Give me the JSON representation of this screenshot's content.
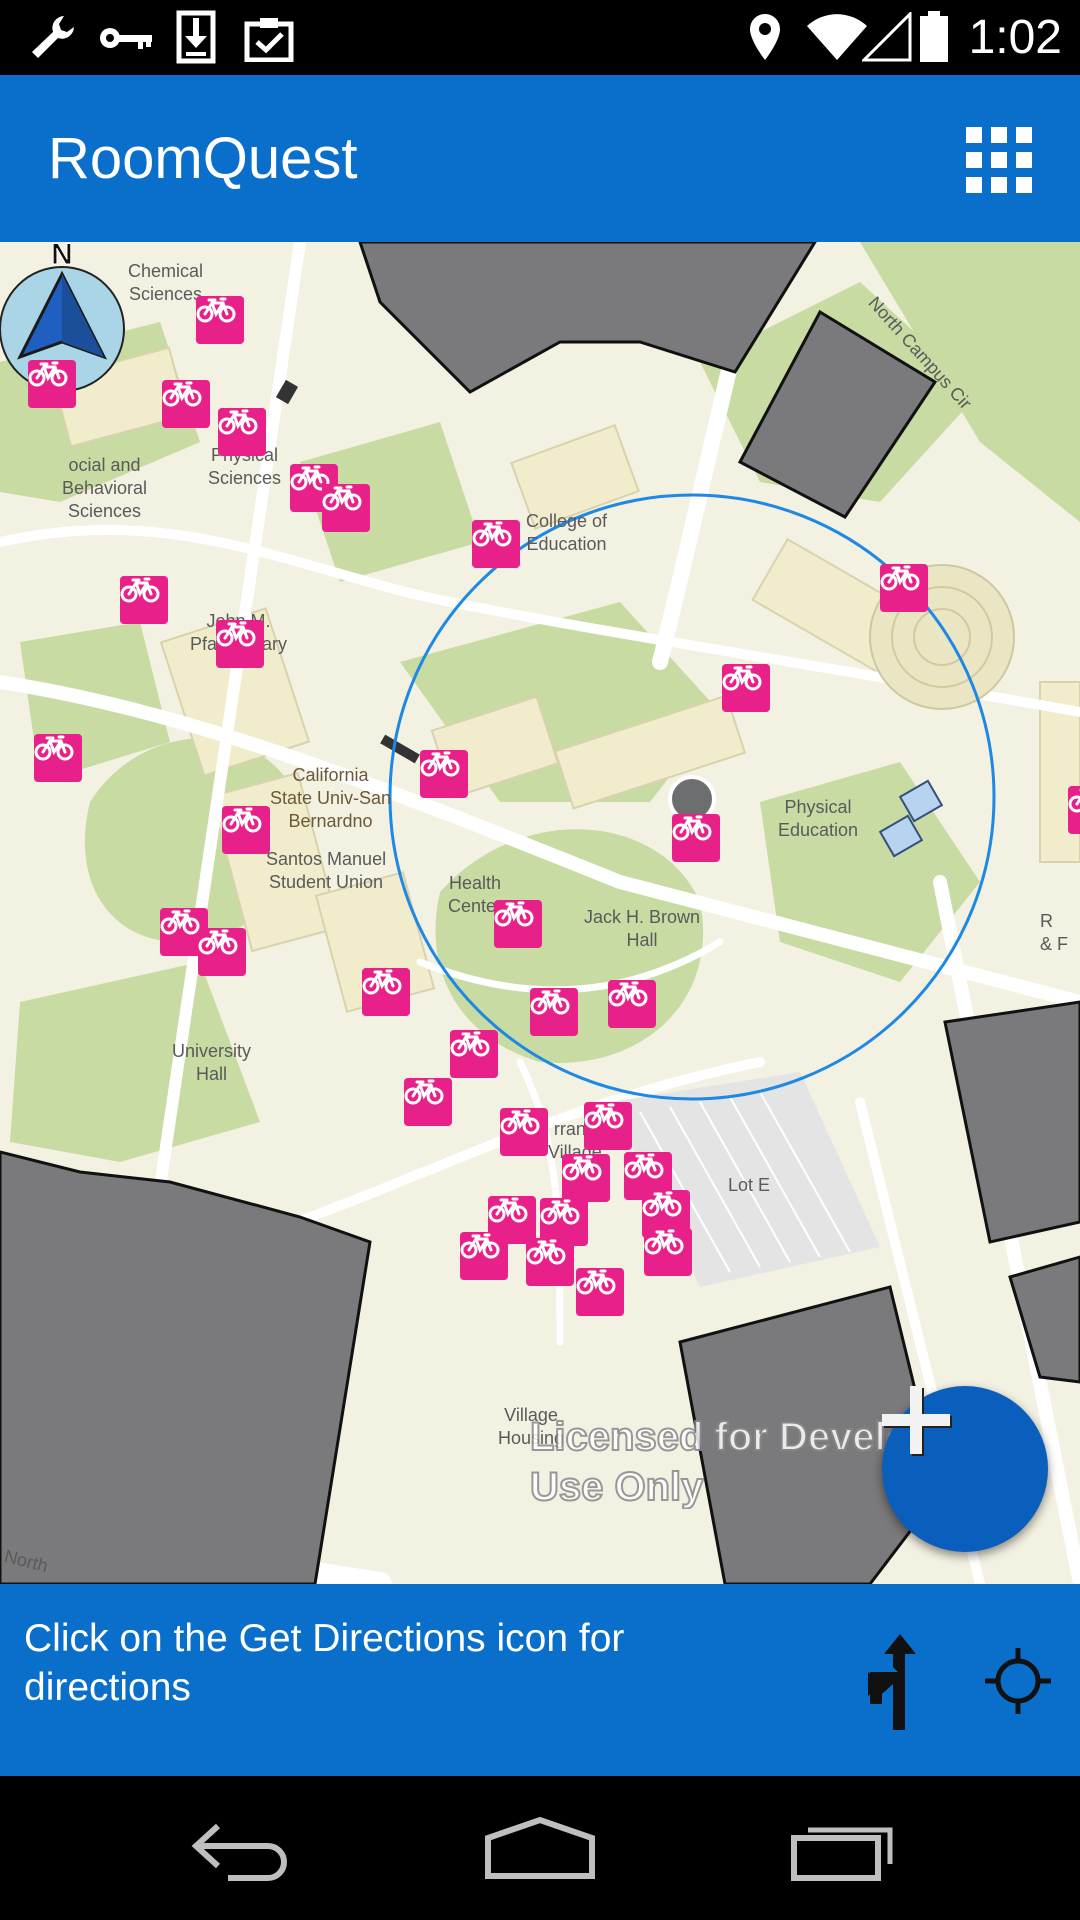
{
  "status_bar": {
    "time": "1:02",
    "left_icons": [
      "wrench-icon",
      "key-icon",
      "download-icon",
      "clipboard-check-icon"
    ],
    "right_icons": [
      "location-pin-icon",
      "wifi-icon",
      "cell-signal-icon",
      "battery-icon"
    ]
  },
  "app_bar": {
    "title": "RoomQuest",
    "menu_icon": "grid-apps-icon"
  },
  "map": {
    "compass_label": "N",
    "labels": {
      "chemical_sciences": "Chemical\nSciences",
      "physical_sciences": "Physical\nSciences",
      "social_behavioral": "ocial and\nBehavioral\nSciences",
      "college_of_education": "College of\nEducation",
      "pfau_library": "John M.\nPfau Library",
      "csusb": "California\nState Univ-San\nBernardno",
      "student_union": "Santos Manuel\nStudent Union",
      "health_center": "Health\nCenter",
      "jack_brown_hall": "Jack H. Brown\nHall",
      "physical_education": "Physical\nEducation",
      "university_hall": "University\nHall",
      "serrano_village": "rrano\nVillage",
      "lot_e": "Lot E",
      "village_housing": "Village\nHousing",
      "north_campus_cir": "North Campus Cir",
      "north_road": "North",
      "edge_label": "R\n& F"
    },
    "watermark": "Licensed for Developer\nUse Only",
    "marker_icon": "bicycle-icon",
    "colors": {
      "bike_marker": "#e8208a",
      "building": "#7a797b",
      "grass": "#c8dba3",
      "accuracy_ring": "#1e88e5"
    }
  },
  "fab": {
    "icon": "plus-icon"
  },
  "bottom_panel": {
    "message": "Click on the Get Directions icon for directions",
    "directions_icon": "turn-directions-icon",
    "locate_icon": "crosshair-locate-icon"
  },
  "nav_bar": {
    "icons": [
      "back-icon",
      "home-icon",
      "recent-apps-icon"
    ]
  },
  "theme": {
    "primary": "#0a6fcb",
    "fab": "#0a5fbd"
  }
}
